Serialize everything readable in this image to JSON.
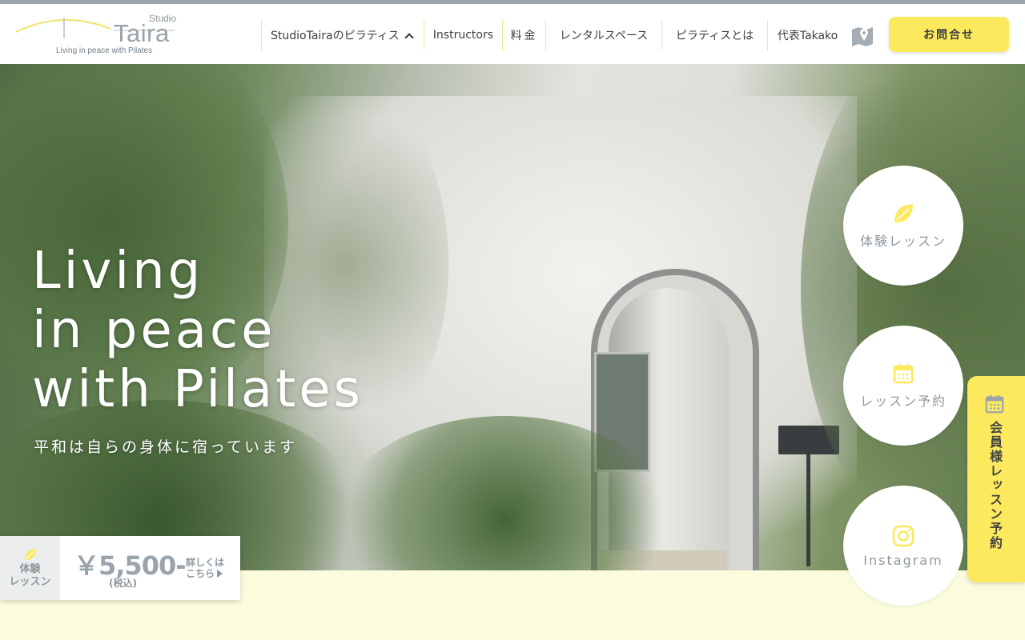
{
  "header": {
    "logo": {
      "studio": "Studio",
      "name": "Taira",
      "tagline": "Living in peace with Pilates"
    },
    "nav": [
      {
        "label": "StudioTairaのピラティス",
        "icon": "chevron-up-icon"
      },
      {
        "label": "Instructors"
      },
      {
        "label": "料金"
      },
      {
        "label": "レンタルスペース"
      },
      {
        "label": "ピラティスとは"
      },
      {
        "label": "代表Takako"
      }
    ],
    "map_icon": "map-icon",
    "contact_label": "お問合せ"
  },
  "hero": {
    "title_lines": [
      "Living",
      "in peace",
      "with Pilates"
    ],
    "subtitle": "平和は自らの身体に宿っています"
  },
  "side_buttons": [
    {
      "label": "体験レッスン",
      "icon": "leaf-icon"
    },
    {
      "label": "レッスン予約",
      "icon": "calendar-icon"
    },
    {
      "label": "Instagram",
      "icon": "instagram-icon"
    }
  ],
  "member_tab": {
    "label": "会員様レッスン予約",
    "icon": "calendar-icon"
  },
  "trial_card": {
    "label_line1": "体験",
    "label_line2": "レッスン",
    "price": "￥5,500-",
    "tax_note": "(税込)",
    "more_line1": "詳しくは",
    "more_line2": "こちら"
  },
  "colors": {
    "accent_yellow": "#fde95d",
    "text_gray": "#8d989f",
    "stripe": "#9aa4ab",
    "page_bg": "#fbfcde"
  }
}
